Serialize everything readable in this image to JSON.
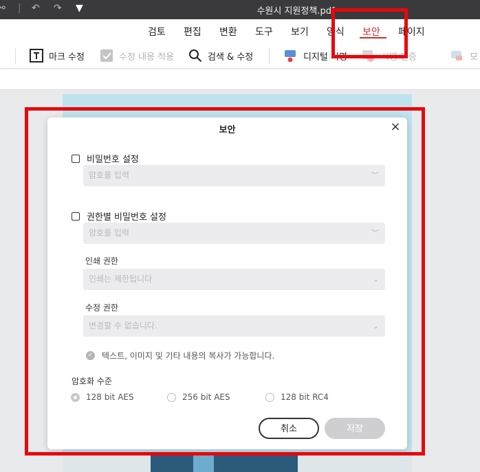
{
  "titlebar": {
    "title": "수원시 지원정책.pdf",
    "share_icon": "share-icon",
    "undo_icon": "undo-icon",
    "redo_icon": "redo-icon",
    "quickaccess_icon": "dropdown-arrow-icon"
  },
  "menu": {
    "items": [
      {
        "label": "검토"
      },
      {
        "label": "편집"
      },
      {
        "label": "변환"
      },
      {
        "label": "도구"
      },
      {
        "label": "보기"
      },
      {
        "label": "양식"
      },
      {
        "label": "보안"
      },
      {
        "label": "페이지"
      }
    ],
    "active_color": "#d0302b"
  },
  "toolbar": {
    "mark_edit": "마크 수정",
    "apply_edit": "수정 내용 적용",
    "search_edit": "검색 & 수정",
    "digital_sign": "디지털 서명",
    "verify_sign": "서명 인증",
    "more": "모"
  },
  "dialog": {
    "title": "보안",
    "password": {
      "label": "비밀번호 설정",
      "placeholder": "암호를 입력"
    },
    "permission": {
      "label": "권한별 비밀번호 설정",
      "placeholder": "암호를 입력"
    },
    "print": {
      "label": "인쇄 권한",
      "value": "인쇄는 제한됩니다"
    },
    "edit": {
      "label": "수정 권한",
      "value": "변경할 수 없습니다."
    },
    "hint": "텍스트, 이미지 및 기타 내용의 복사가 가능합니다.",
    "encryption": {
      "label": "암호화 수준",
      "options": [
        {
          "label": "128 bit AES",
          "selected": true
        },
        {
          "label": "256 bit AES",
          "selected": false
        },
        {
          "label": "128 bit RC4",
          "selected": false
        }
      ]
    },
    "cancel_label": "취소",
    "save_label": "저장"
  },
  "colors": {
    "annotation": "#e8070e",
    "titlebar": "#3a3a3c",
    "pdf_bg": "#bfe3ee"
  }
}
